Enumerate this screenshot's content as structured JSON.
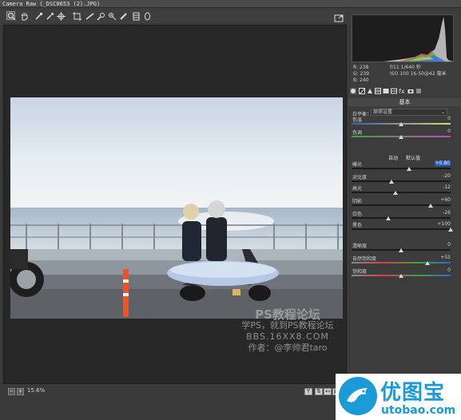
{
  "window": {
    "title": "Camera Raw (_DSC0653 (2).JPG)"
  },
  "toolbar": {
    "tools": [
      {
        "name": "zoom-tool-icon",
        "active": true
      },
      {
        "name": "hand-tool-icon",
        "active": false
      },
      {
        "name": "white-balance-tool-icon",
        "active": false
      },
      {
        "name": "color-sampler-tool-icon",
        "active": false
      },
      {
        "name": "targeted-adjustment-tool-icon",
        "active": false
      },
      {
        "name": "crop-tool-icon",
        "active": false
      },
      {
        "name": "straighten-tool-icon",
        "active": false
      },
      {
        "name": "spot-removal-tool-icon",
        "active": false
      },
      {
        "name": "red-eye-tool-icon",
        "active": false
      },
      {
        "name": "adjustment-brush-icon",
        "active": false
      },
      {
        "name": "graduated-filter-icon",
        "active": false
      },
      {
        "name": "radial-filter-icon",
        "active": false
      }
    ]
  },
  "readout": {
    "r": "R:  238",
    "g": "G:  239",
    "b": "B:  240",
    "exif_line1": "f/11   1/640 秒",
    "exif_line2": "ISO 100   16-50@42 毫米"
  },
  "panel": {
    "section_title": "基本",
    "white_balance_label": "白平衡：",
    "white_balance_value": "原照设置",
    "auto_label": "自动",
    "default_label": "默认值",
    "sliders": [
      {
        "id": "temperature",
        "label": "色温",
        "value": "0",
        "position": 0.5
      },
      {
        "id": "tint",
        "label": "色调",
        "value": "0",
        "position": 0.5
      },
      {
        "id": "exposure",
        "label": "曝光",
        "value": "+0.80",
        "position": 0.58,
        "highlight": true
      },
      {
        "id": "contrast",
        "label": "对比度",
        "value": "-20",
        "position": 0.4
      },
      {
        "id": "highlights",
        "label": "高光",
        "value": "-12",
        "position": 0.44
      },
      {
        "id": "shadows",
        "label": "阴影",
        "value": "+60",
        "position": 0.8
      },
      {
        "id": "whites",
        "label": "白色",
        "value": "-26",
        "position": 0.37
      },
      {
        "id": "blacks",
        "label": "黑色",
        "value": "+100",
        "position": 1.0
      },
      {
        "id": "clarity",
        "label": "清晰度",
        "value": "0",
        "position": 0.5
      },
      {
        "id": "vibrance",
        "label": "自然饱和度",
        "value": "+55",
        "position": 0.77
      },
      {
        "id": "saturation",
        "label": "饱和度",
        "value": "0",
        "position": 0.5
      }
    ]
  },
  "status": {
    "zoom": "15.6%"
  },
  "watermark": {
    "line1": "PS教程论坛",
    "line2": "学PS，就到PS教程论坛",
    "line3": "BBS.16XX8.COM",
    "line4": "作者：@李帅君taro"
  },
  "logo": {
    "name": "优图宝",
    "url": "utobao.com"
  },
  "colors": {
    "accent": "#2d5fbf",
    "logo_blue": "#1a9ad6"
  }
}
